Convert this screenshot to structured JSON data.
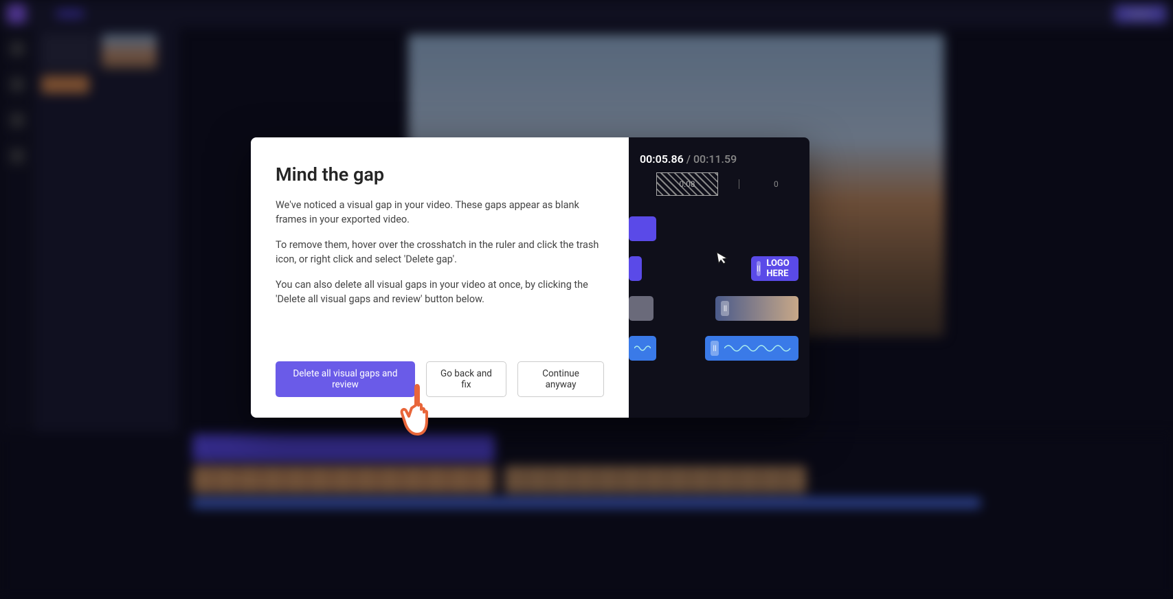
{
  "topbar": {
    "export_label": "Export"
  },
  "modal": {
    "title": "Mind the gap",
    "para1": "We've noticed a visual gap in your video. These gaps appear as blank frames in your exported video.",
    "para2": "To remove them, hover over the crosshatch in the ruler and click the trash icon, or right click and select 'Delete gap'.",
    "para3": "You can also delete all visual gaps in your video at once, by clicking the 'Delete all visual gaps and review' button below.",
    "btn_primary": "Delete all visual gaps and review",
    "btn_back": "Go back and fix",
    "btn_continue": "Continue anyway"
  },
  "preview_panel": {
    "time_current": "00:05.86",
    "time_total": "00:11.59",
    "tick_a": "0:08",
    "tick_b": "0",
    "logo_clip_label": "LOGO HERE"
  }
}
